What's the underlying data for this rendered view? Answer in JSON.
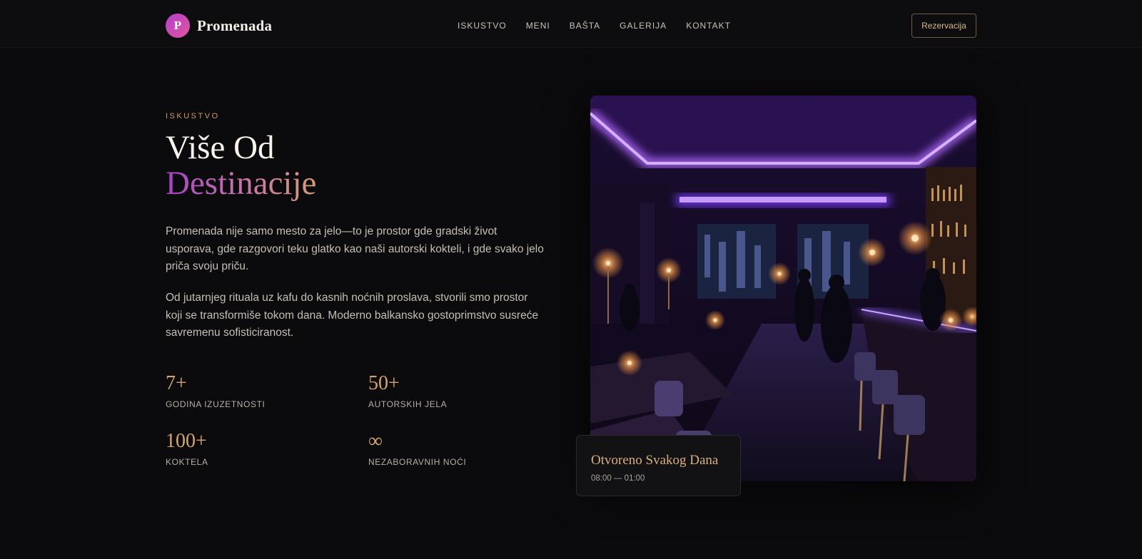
{
  "header": {
    "logo_letter": "P",
    "brand": "Promenada",
    "nav": [
      "ISKUSTVO",
      "MENI",
      "BAŠTA",
      "GALERIJA",
      "KONTAKT"
    ],
    "reserve_label": "Rezervacija"
  },
  "hero": {
    "eyebrow": "ISKUSTVO",
    "title_line1": "Više Od",
    "title_line2": "Destinacije",
    "paragraph1": "Promenada nije samo mesto za jelo—to je prostor gde gradski život usporava, gde razgovori teku glatko kao naši autorski kokteli, i gde svako jelo priča svoju priču.",
    "paragraph2": "Od jutarnjeg rituala uz kafu do kasnih noćnih proslava, stvorili smo prostor koji se transformiše tokom dana. Moderno balkansko gostoprimstvo susreće savremenu sofisticiranost."
  },
  "stats": [
    {
      "value": "7+",
      "label": "GODINA IZUZETNOSTI"
    },
    {
      "value": "50+",
      "label": "AUTORSKIH JELA"
    },
    {
      "value": "100+",
      "label": "KOKTELA"
    },
    {
      "value": "∞",
      "label": "NEZABORAVNIH NOĆI"
    }
  ],
  "hours_card": {
    "title": "Otvoreno Svakog Dana",
    "time": "08:00 — 01:00"
  },
  "colors": {
    "background": "#0b0a0c",
    "accent_gold": "#d3a474",
    "accent_purple": "#a640c8",
    "neon": "#8a3cff"
  }
}
